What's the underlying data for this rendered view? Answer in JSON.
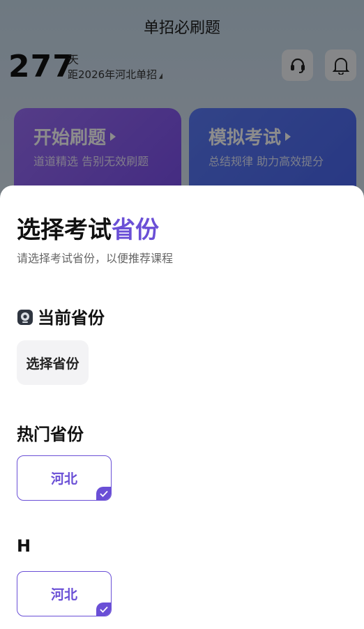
{
  "app": {
    "title": "单招必刷题"
  },
  "countdown": {
    "days": "277",
    "unit": "天",
    "target": "距2026年河北单招"
  },
  "cards": [
    {
      "title": "开始刷题",
      "subtitle": "道道精选 告别无效刷题"
    },
    {
      "title": "模拟考试",
      "subtitle": "总结规律 助力高效提分"
    }
  ],
  "sheet": {
    "title_main": "选择考试",
    "title_highlight": "省份",
    "subtitle": "请选择考试省份，以便推荐课程",
    "current": {
      "title": "当前省份",
      "chip": "选择省份"
    },
    "hot": {
      "title": "热门省份",
      "chip": "河北"
    },
    "group_h": {
      "letter": "H",
      "chip": "河北"
    }
  },
  "colors": {
    "accent": "#6a4fd6"
  }
}
